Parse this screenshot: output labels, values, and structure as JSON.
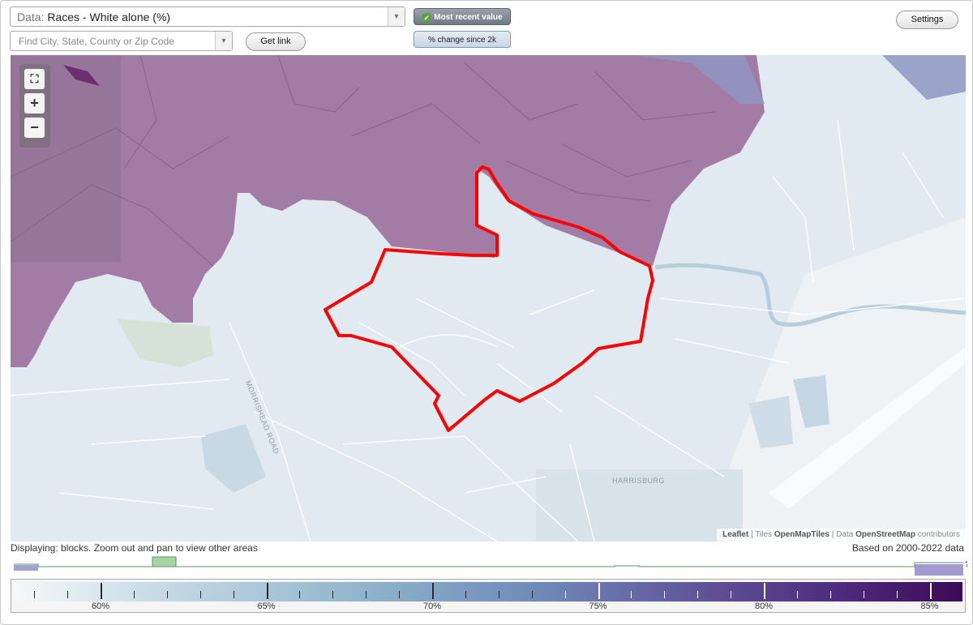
{
  "top": {
    "data_prefix": "Data:",
    "data_value": "Races - White alone (%)",
    "search_placeholder": "Find City, State, County or Zip Code",
    "get_link": "Get link",
    "mode_active": "Most recent value",
    "mode_inactive": "% change since 2k",
    "settings": "Settings"
  },
  "map": {
    "zoom_fullscreen": "⛶",
    "zoom_in": "+",
    "zoom_out": "−",
    "labels": {
      "road": "MORRISHEAD ROAD",
      "place": "HARRISBURG"
    },
    "attribution": {
      "leaflet": "Leaflet",
      "sep1": " | Tiles ",
      "tiles": "OpenMapTiles",
      "sep2": " | Data ",
      "osm": "OpenStreetMap",
      "suffix": " contributors"
    },
    "colors": {
      "background": "#e1eaf0",
      "high_value_fill": "#a27ca5",
      "boundary": "#ff0000"
    }
  },
  "bottom": {
    "status": "Displaying: blocks. Zoom out and pan to view other areas",
    "based_on": "Based on 2000-2022 data",
    "legend_labels": [
      "60%",
      "65%",
      "70%",
      "75%",
      "80%",
      "85%"
    ],
    "histogram_help": "?"
  }
}
